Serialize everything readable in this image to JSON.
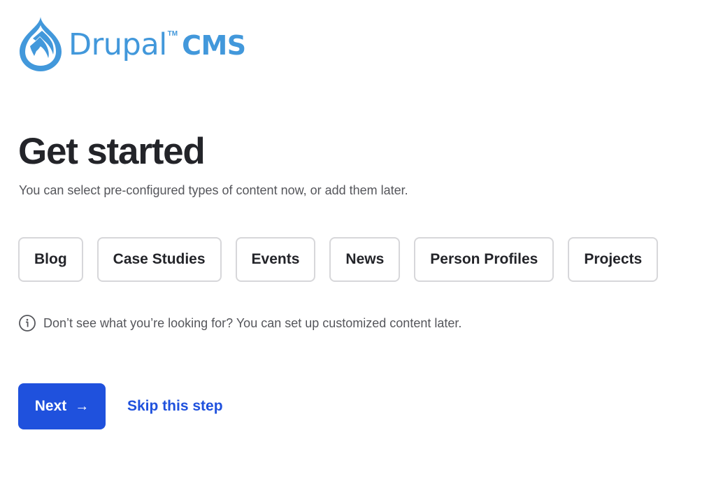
{
  "brand": {
    "name": "Drupal",
    "trademark": "TM",
    "product": "CMS",
    "color": "#4298db"
  },
  "header": {
    "title": "Get started",
    "subtitle": "You can select pre-configured types of content now, or add them later."
  },
  "options": [
    {
      "label": "Blog"
    },
    {
      "label": "Case Studies"
    },
    {
      "label": "Events"
    },
    {
      "label": "News"
    },
    {
      "label": "Person Profiles"
    },
    {
      "label": "Projects"
    }
  ],
  "hint": {
    "icon": "info-icon",
    "text": "Don’t see what you’re looking for? You can set up customized content later."
  },
  "actions": {
    "next_label": "Next",
    "next_icon": "→",
    "skip_label": "Skip this step",
    "primary_color": "#1f51dd"
  }
}
